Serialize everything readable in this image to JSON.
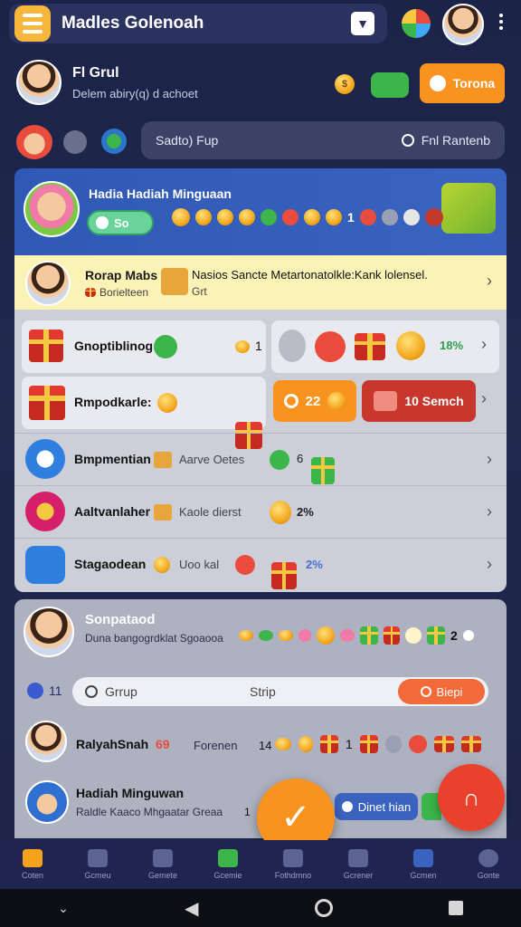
{
  "header": {
    "title": "Madles Golenoah"
  },
  "profile": {
    "name": "Fl Grul",
    "subtitle": "Delem abiry(q) d achoet",
    "action_label": "Torona"
  },
  "search_top": {
    "placeholder": "Sadto) Fup",
    "action_label": "Fnl Rantenb"
  },
  "weekly": {
    "title": "Hadia Hadiah Minguaan",
    "pill_label": "So",
    "count": "1"
  },
  "notice": {
    "title": "Rorap Mabs",
    "sub": "Borielteen",
    "text": "Nasios Sancte Metartonatolkle:Kank lolensel.",
    "text2": "Grt"
  },
  "cards": [
    {
      "title": "Gnoptiblinog",
      "count": "1",
      "percent": "18%"
    },
    {
      "title": "Rmpodkarle:",
      "btn1": "22",
      "btn2": "10 Semch"
    }
  ],
  "rows": [
    {
      "title": "Bmpmentian",
      "sub": "Aarve Oetes",
      "value": "6"
    },
    {
      "title": "Aaltvanlaher",
      "sub": "Kaole dierst",
      "value": "2%"
    },
    {
      "title": "Stagaodean",
      "sub": "Uoo kal",
      "value": "2%"
    }
  ],
  "community": {
    "title": "Sonpataod",
    "sub": "Duna bangogrdklat Sgoaooa",
    "count": "2",
    "small_count": "11",
    "search_placeholder": "Grrup",
    "search_mid": "Strip",
    "block_label": "Biepi",
    "members": [
      {
        "name": "RalyahSnah",
        "sub": "Forenen",
        "num": "14",
        "tag": "69"
      },
      {
        "name": "Hadiah Minguwan",
        "sub": "Raldle Kaaco Mhgaatar Greaa",
        "num": "1"
      }
    ],
    "pill_label": "Dinet hian"
  },
  "nav": [
    "Coten",
    "Gcmeu",
    "Gemete",
    "Gcemie",
    "Fothdmno",
    "Gcrener",
    "Gcmen",
    "Gonte"
  ],
  "colors": {
    "accent": "#f7931e",
    "primary": "#2f59b5",
    "success": "#3cb54a"
  }
}
